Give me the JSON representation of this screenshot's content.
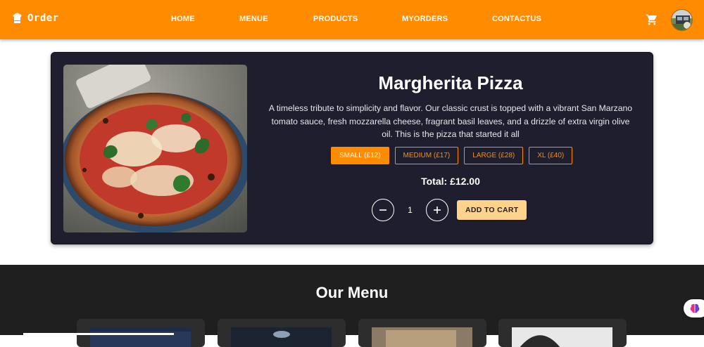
{
  "navbar": {
    "brand": "Order",
    "brand_icon": "chef-hat-icon",
    "links": [
      "HOME",
      "MENUE",
      "PRODUCTS",
      "MYORDERS",
      "CONTACTUS"
    ],
    "cart_icon": "shopping-cart-icon",
    "colors": {
      "background": "#ff8c00",
      "text": "#ffffff"
    }
  },
  "product": {
    "title": "Margherita Pizza",
    "description": "A timeless tribute to simplicity and flavor. Our classic crust is topped with a vibrant San Marzano tomato sauce, fresh mozzarella cheese, fragrant basil leaves, and a drizzle of extra virgin olive oil. This is the pizza that started it all",
    "sizes": [
      {
        "label": "SMALL (£12)",
        "selected": true
      },
      {
        "label": "MEDIUM (£17)",
        "selected": false
      },
      {
        "label": "LARGE (£28)",
        "selected": false
      },
      {
        "label": "XL (£40)",
        "selected": false
      }
    ],
    "total": "Total: £12.00",
    "quantity": "1",
    "decrement_icon": "minus-icon",
    "increment_icon": "plus-icon",
    "add_to_cart": "ADD TO CART",
    "colors": {
      "card": "#1f1e2e",
      "accent": "#ff8c00",
      "add_button": "#fdd28a"
    }
  },
  "menu": {
    "title": "Our Menu",
    "background": "#1f1f1f"
  },
  "assistant_icon": "brain-icon"
}
